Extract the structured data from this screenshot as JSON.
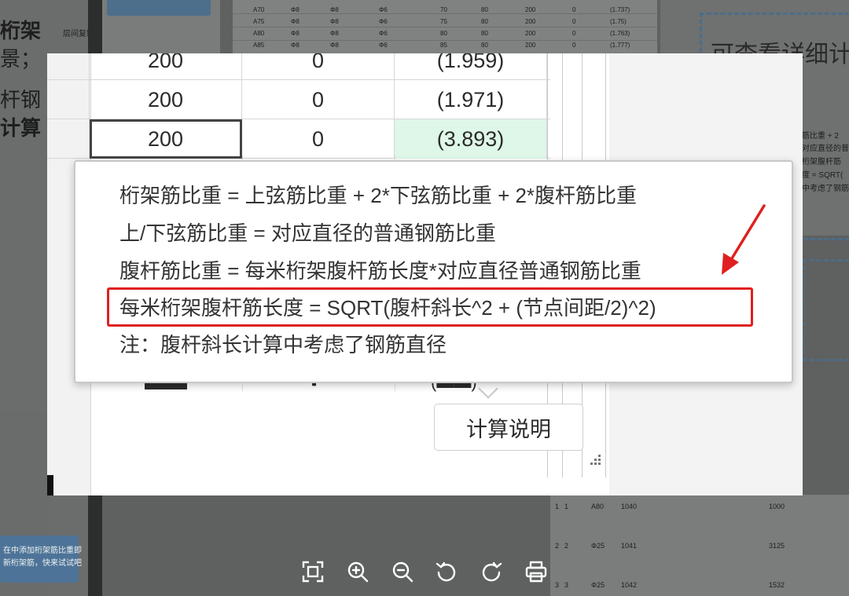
{
  "background": {
    "left_text": [
      "桁架",
      "景；",
      "杆钢",
      "计算"
    ],
    "btn_label": "层间复制",
    "sheet_rows": [
      [
        "A70",
        "Φ8",
        "Φ8",
        "Φ6",
        "70",
        "80",
        "200",
        "0",
        "(1.737)"
      ],
      [
        "A75",
        "Φ8",
        "Φ8",
        "Φ6",
        "75",
        "80",
        "200",
        "0",
        "(1.75)"
      ],
      [
        "A80",
        "Φ8",
        "Φ8",
        "Φ6",
        "80",
        "80",
        "200",
        "0",
        "(1.763)"
      ],
      [
        "A85",
        "Φ8",
        "Φ8",
        "Φ6",
        "85",
        "80",
        "200",
        "0",
        "(1.777)"
      ]
    ],
    "right_title": "可查看详细计",
    "right_lines": [
      "筋比重 + 2",
      "对应直径的普",
      "桁架腹杆筋",
      "度 = SQRT(",
      "中考虑了钢筋"
    ],
    "tip_lines": [
      "在中添加桁架筋比重即",
      "新桁架筋，快来试试吧"
    ],
    "bottom_right_rows": [
      [
        "1",
        "1",
        "A80",
        "1040",
        "1000"
      ],
      [
        "2",
        "2",
        "Φ25",
        "1041",
        "3125"
      ],
      [
        "3",
        "3",
        "Φ25",
        "1042",
        "1532"
      ]
    ]
  },
  "grid": {
    "rows": [
      {
        "c1": "200",
        "c2": "0",
        "c3": "(1.959)"
      },
      {
        "c1": "200",
        "c2": "0",
        "c3": "(1.971)"
      },
      {
        "c1": "200",
        "c2": "0",
        "c3": "(3.893)"
      }
    ]
  },
  "tooltip": {
    "lines": [
      "桁架筋比重 = 上弦筋比重 + 2*下弦筋比重 + 2*腹杆筋比重",
      "上/下弦筋比重 = 对应直径的普通钢筋比重",
      "腹杆筋比重 = 每米桁架腹杆筋长度*对应直径普通钢筋比重",
      "每米桁架腹杆筋长度 = SQRT(腹杆斜长^2 + (节点间距/2)^2)",
      "注：腹杆斜长计算中考虑了钢筋直径"
    ]
  },
  "calc_button": {
    "label": "计算说明"
  },
  "toolbar": {
    "items": [
      {
        "name": "fit-screen",
        "icon": "fit-screen-icon"
      },
      {
        "name": "zoom-in",
        "icon": "zoom-in-icon"
      },
      {
        "name": "zoom-out",
        "icon": "zoom-out-icon"
      },
      {
        "name": "rotate-left",
        "icon": "rotate-left-icon"
      },
      {
        "name": "rotate-right",
        "icon": "rotate-right-icon"
      },
      {
        "name": "print",
        "icon": "print-icon"
      }
    ]
  },
  "colors": {
    "highlight_red": "#e02020",
    "cell_highlight": "#def7e8",
    "overlay": "#5f6060"
  }
}
